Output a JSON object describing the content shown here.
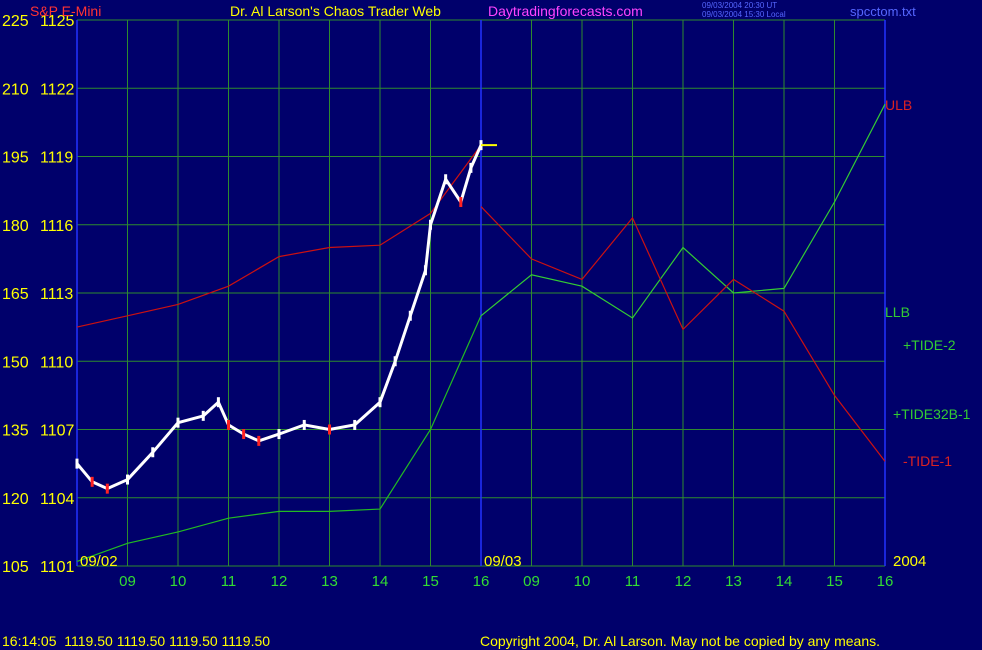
{
  "header": {
    "instrument": "S&P E-Mini",
    "title": "Dr. Al Larson's Chaos Trader Web",
    "site": "Daytradingforecasts.com",
    "stamp_ut": "09/03/2004 20:30 UT",
    "stamp_local": "09/03/2004 15:30 Local",
    "filename": "spcctom.txt"
  },
  "footer": {
    "quote": "16:14:05  1119.50 1119.50 1119.50 1119.50",
    "copyright": "Copyright 2004, Dr. Al Larson. May not be copied by any means."
  },
  "colors": {
    "background": "#00006b",
    "grid": "#2e8b2e",
    "session_divider": "#2233ff",
    "price_axis": "#ffff00",
    "ulb": "#cc1111",
    "llb": "#22bb22",
    "tide_green": "#33cc33",
    "tide_red": "#cc1111",
    "bars_up": "#ffffff",
    "bars_down": "#ff2222"
  },
  "chart_data": {
    "type": "line",
    "x_tick_labels": [
      "09",
      "10",
      "11",
      "12",
      "13",
      "14",
      "15",
      "16",
      "09",
      "10",
      "11",
      "12",
      "13",
      "14",
      "15",
      "16"
    ],
    "date_labels": [
      "09/02",
      "09/03"
    ],
    "year_label": "2004",
    "y_labels_left": [
      "225",
      "210",
      "195",
      "180",
      "165",
      "150",
      "135",
      "120",
      "105"
    ],
    "y_labels_price": [
      "1125",
      "1122",
      "1119",
      "1116",
      "1113",
      "1110",
      "1107",
      "1104",
      "1101"
    ],
    "ylim": [
      1101,
      1125
    ],
    "right_labels": {
      "ulb": "ULB",
      "llb": "LLB",
      "tide2": "+TIDE-2",
      "tide32b": "+TIDE32B-1",
      "tide1": "-TIDE-1"
    },
    "price_series": {
      "name": "S&P E-Mini",
      "x": [
        8.0,
        8.3,
        8.6,
        9.0,
        9.5,
        10.0,
        10.5,
        10.8,
        11.0,
        11.3,
        11.6,
        12.0,
        12.5,
        13.0,
        13.5,
        14.0,
        14.3,
        14.6,
        14.9,
        15.0,
        15.3,
        15.6,
        15.8,
        16.0
      ],
      "y": [
        1105.5,
        1104.7,
        1104.4,
        1104.8,
        1106.0,
        1107.3,
        1107.6,
        1108.2,
        1107.2,
        1106.8,
        1106.5,
        1106.8,
        1107.2,
        1107.0,
        1107.2,
        1108.2,
        1110.0,
        1112.0,
        1114.0,
        1116.0,
        1118.0,
        1117.0,
        1118.5,
        1119.5
      ]
    },
    "series": [
      {
        "name": "ULB",
        "x": [
          8.0,
          9.0,
          10.0,
          11.0,
          12.0,
          13.0,
          14.0,
          15.0,
          16.0
        ],
        "y": [
          1111.5,
          1112.0,
          1112.5,
          1113.3,
          1114.6,
          1115.0,
          1115.1,
          1116.5,
          1119.5
        ]
      },
      {
        "name": "LLB",
        "x": [
          8.0,
          9.0,
          10.0,
          11.0,
          12.0,
          13.0,
          14.0,
          15.0,
          16.0
        ],
        "y": [
          1101.2,
          1102.0,
          1102.5,
          1103.1,
          1103.4,
          1103.4,
          1103.5,
          1107.0,
          1112.0
        ]
      },
      {
        "name": "+TIDE-2",
        "x": [
          16.0,
          17.0,
          18.0,
          19.0,
          20.0,
          21.0,
          22.0,
          23.0,
          24.0
        ],
        "y": [
          1112.0,
          1113.8,
          1113.3,
          1111.9,
          1115.0,
          1113.0,
          1113.2,
          1117.0,
          1121.3
        ]
      },
      {
        "name": "-TIDE-1",
        "x": [
          16.0,
          17.0,
          18.0,
          19.0,
          20.0,
          21.0,
          22.0,
          23.0,
          24.0
        ],
        "y": [
          1116.8,
          1114.5,
          1113.6,
          1116.3,
          1111.4,
          1113.6,
          1112.2,
          1108.5,
          1105.6
        ]
      }
    ]
  }
}
